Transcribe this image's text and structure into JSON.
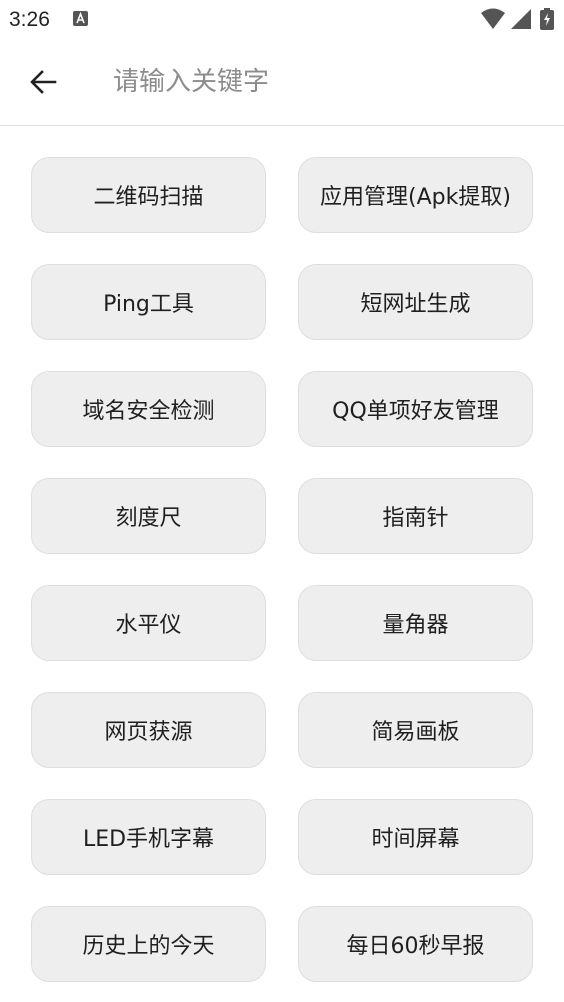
{
  "status_bar": {
    "time": "3:26",
    "icons": [
      "a-notification-icon",
      "wifi-icon",
      "cell-signal-icon",
      "battery-charging-icon"
    ]
  },
  "app_bar": {
    "back_icon": "arrow-left-icon",
    "search_placeholder": "请输入关键字",
    "search_value": ""
  },
  "tools": [
    {
      "label": "二维码扫描"
    },
    {
      "label": "应用管理(Apk提取)"
    },
    {
      "label": "Ping工具"
    },
    {
      "label": "短网址生成"
    },
    {
      "label": "域名安全检测"
    },
    {
      "label": "QQ单项好友管理"
    },
    {
      "label": "刻度尺"
    },
    {
      "label": "指南针"
    },
    {
      "label": "水平仪"
    },
    {
      "label": "量角器"
    },
    {
      "label": "网页获源"
    },
    {
      "label": "简易画板"
    },
    {
      "label": "LED手机字幕"
    },
    {
      "label": "时间屏幕"
    },
    {
      "label": "历史上的今天"
    },
    {
      "label": "每日60秒早报"
    }
  ],
  "colors": {
    "button_bg": "#eeeeee",
    "button_border": "#dedede",
    "placeholder": "#8c8c8c",
    "divider": "#dddddd"
  }
}
